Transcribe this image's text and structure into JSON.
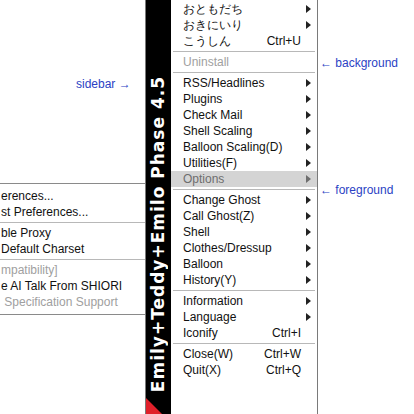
{
  "annotations": {
    "sidebar": "sidebar →",
    "background": "← background",
    "foreground": "← foreground"
  },
  "sidebar": {
    "title": "Emily+Teddy+Emilo Phase 4.5"
  },
  "menu": {
    "items": [
      {
        "kind": "item",
        "label": "おともだち",
        "submenu": true,
        "disabled": false,
        "selected": false
      },
      {
        "kind": "item",
        "label": "おきにいり",
        "submenu": true,
        "disabled": false,
        "selected": false
      },
      {
        "kind": "item",
        "label": "こうしん",
        "shortcut": "Ctrl+U",
        "submenu": false,
        "disabled": false,
        "selected": false
      },
      {
        "kind": "separator"
      },
      {
        "kind": "item",
        "label": "Uninstall",
        "submenu": false,
        "disabled": true,
        "selected": false
      },
      {
        "kind": "separator"
      },
      {
        "kind": "item",
        "label": "RSS/Headlines",
        "submenu": true,
        "disabled": false,
        "selected": false
      },
      {
        "kind": "item",
        "label": "Plugins",
        "submenu": true,
        "disabled": false,
        "selected": false
      },
      {
        "kind": "item",
        "label": "Check Mail",
        "submenu": true,
        "disabled": false,
        "selected": false
      },
      {
        "kind": "item",
        "label": "Shell Scaling",
        "submenu": true,
        "disabled": false,
        "selected": false
      },
      {
        "kind": "item",
        "label": "Balloon Scaling(D)",
        "submenu": true,
        "disabled": false,
        "selected": false
      },
      {
        "kind": "item",
        "label": "Utilities(F)",
        "submenu": true,
        "disabled": false,
        "selected": false
      },
      {
        "kind": "item",
        "label": "Options",
        "submenu": true,
        "disabled": false,
        "selected": true
      },
      {
        "kind": "separator"
      },
      {
        "kind": "item",
        "label": "Change Ghost",
        "submenu": true,
        "disabled": false,
        "selected": false
      },
      {
        "kind": "item",
        "label": "Call Ghost(Z)",
        "submenu": true,
        "disabled": false,
        "selected": false
      },
      {
        "kind": "item",
        "label": "Shell",
        "submenu": true,
        "disabled": false,
        "selected": false
      },
      {
        "kind": "item",
        "label": "Clothes/Dressup",
        "submenu": true,
        "disabled": false,
        "selected": false
      },
      {
        "kind": "item",
        "label": "Balloon",
        "submenu": true,
        "disabled": false,
        "selected": false
      },
      {
        "kind": "item",
        "label": "History(Y)",
        "submenu": true,
        "disabled": false,
        "selected": false
      },
      {
        "kind": "separator"
      },
      {
        "kind": "item",
        "label": "Information",
        "submenu": true,
        "disabled": false,
        "selected": false
      },
      {
        "kind": "item",
        "label": "Language",
        "submenu": true,
        "disabled": false,
        "selected": false
      },
      {
        "kind": "item",
        "label": "Iconify",
        "shortcut": "Ctrl+I",
        "submenu": false,
        "disabled": false,
        "selected": false
      },
      {
        "kind": "separator"
      },
      {
        "kind": "item",
        "label": "Close(W)",
        "shortcut": "Ctrl+W",
        "submenu": false,
        "disabled": false,
        "selected": false
      },
      {
        "kind": "item",
        "label": "Quit(X)",
        "shortcut": "Ctrl+Q",
        "submenu": false,
        "disabled": false,
        "selected": false
      }
    ]
  },
  "submenu": {
    "items": [
      {
        "kind": "item",
        "label": "erences...",
        "disabled": false
      },
      {
        "kind": "item",
        "label": "st Preferences...",
        "disabled": false
      },
      {
        "kind": "separator"
      },
      {
        "kind": "item",
        "label": "ble Proxy",
        "disabled": false
      },
      {
        "kind": "item",
        "label": "Default Charset",
        "disabled": false
      },
      {
        "kind": "separator"
      },
      {
        "kind": "item",
        "label": "mpatibility]",
        "disabled": true
      },
      {
        "kind": "item",
        "label": "e AI Talk From SHIORI",
        "disabled": false
      },
      {
        "kind": "item",
        "label": " Specification Support",
        "disabled": true
      }
    ]
  }
}
